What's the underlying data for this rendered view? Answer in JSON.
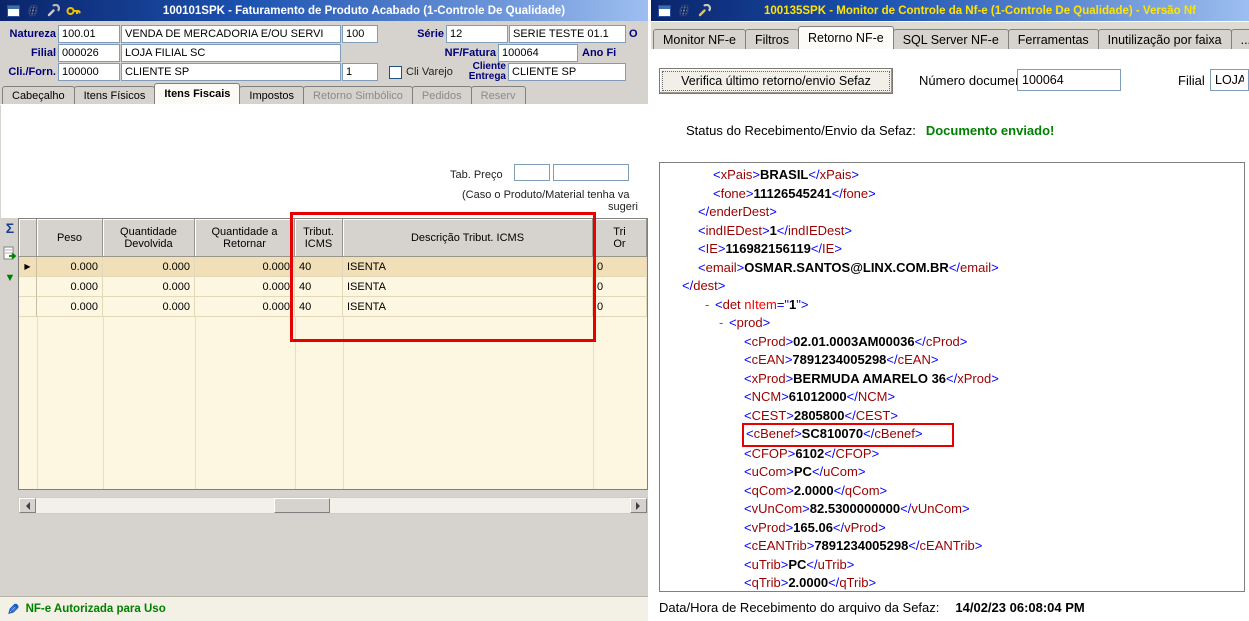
{
  "colors": {
    "status_green": "#008000",
    "highlight_red": "#e60000",
    "xml_tag": "#990000",
    "xml_bracket": "#0000ff",
    "titlebar_blue": "#0a246a"
  },
  "left_window": {
    "title": "100101SPK - Faturamento de Produto Acabado (1-Controle De Qualidade)",
    "form": {
      "natureza_label": "Natureza",
      "natureza_code": "100.01",
      "natureza_desc": "VENDA DE MERCADORIA E/OU SERVI",
      "natureza_num": "100",
      "serie_label": "Série",
      "serie_code": "12",
      "serie_desc": "SERIE TESTE 01.1",
      "right_fragment_row1": "O",
      "filial_label": "Filial",
      "filial_code": "000026",
      "filial_desc": "LOJA FILIAL SC",
      "nf_label": "NF/Fatura",
      "nf_value": "100064",
      "right_fragment_row2": "Ano Fi",
      "cli_label": "Cli./Forn.",
      "cli_code": "100000",
      "cli_desc": "CLIENTE SP",
      "cli_num": "1",
      "cli_varejo_label": "Cli Varejo",
      "cliente_entrega_label": "Cliente\nEntrega",
      "cliente_entrega_value": "CLIENTE SP"
    },
    "tabs": [
      {
        "label": "Cabeçalho",
        "state": "normal"
      },
      {
        "label": "Itens Físicos",
        "state": "normal"
      },
      {
        "label": "Itens Fiscais",
        "state": "active"
      },
      {
        "label": "Impostos",
        "state": "normal"
      },
      {
        "label": "Retorno Simbólico",
        "state": "disabled"
      },
      {
        "label": "Pedidos",
        "state": "disabled"
      },
      {
        "label": "Reserv",
        "state": "disabled"
      }
    ],
    "tab_preco": {
      "label": "Tab. Preço",
      "value1": "",
      "value2": ""
    },
    "note_line1": "(Caso o Produto/Material tenha va",
    "note_line2": "sugeri",
    "grid": {
      "headers": [
        "",
        "Peso",
        "Quantidade\nDevolvida",
        "Quantidade a\nRetornar",
        "Tribut.\nICMS",
        "Descrição Tribut. ICMS",
        "Tri\nOr"
      ],
      "rows": [
        {
          "peso": "0.000",
          "qtd_devolvida": "0.000",
          "qtd_retornar": "0.000",
          "tribut_icms": "40",
          "descricao_tribut_icms": "ISENTA",
          "tri": "0",
          "selected": true
        },
        {
          "peso": "0.000",
          "qtd_devolvida": "0.000",
          "qtd_retornar": "0.000",
          "tribut_icms": "40",
          "descricao_tribut_icms": "ISENTA",
          "tri": "0",
          "selected": false
        },
        {
          "peso": "0.000",
          "qtd_devolvida": "0.000",
          "qtd_retornar": "0.000",
          "tribut_icms": "40",
          "descricao_tribut_icms": "ISENTA",
          "tri": "0",
          "selected": false
        }
      ]
    },
    "statusbar": {
      "message": "NF-e Autorizada para Uso"
    }
  },
  "right_window": {
    "title": "100135SPK - Monitor de Controle da Nf-e (1-Controle De Qualidade) - Versão Nf",
    "tabs": [
      {
        "label": "Monitor NF-e",
        "state": "normal"
      },
      {
        "label": "Filtros",
        "state": "normal"
      },
      {
        "label": "Retorno NF-e",
        "state": "active"
      },
      {
        "label": "SQL Server NF-e",
        "state": "normal"
      },
      {
        "label": "Ferramentas",
        "state": "normal"
      },
      {
        "label": "Inutilização por faixa",
        "state": "normal"
      },
      {
        "label": "...",
        "state": "normal"
      }
    ],
    "toolbar": {
      "verify_button_label": "Verifica último retorno/envio Sefaz",
      "numero_documento_label": "Número documento",
      "numero_documento_value": "100064",
      "filial_label": "Filial",
      "filial_value": "LOJA FILIA"
    },
    "status": {
      "label": "Status do Recebimento/Envio da Sefaz:",
      "value": "Documento enviado!"
    },
    "xml_lines": [
      {
        "depth": 3,
        "type": "leaf",
        "tag": "xPais",
        "value": "BRASIL"
      },
      {
        "depth": 3,
        "type": "leaf",
        "tag": "fone",
        "value": "11126545241"
      },
      {
        "depth": 2,
        "type": "close",
        "tag": "enderDest"
      },
      {
        "depth": 2,
        "type": "leaf",
        "tag": "indIEDest",
        "value": "1"
      },
      {
        "depth": 2,
        "type": "leaf",
        "tag": "IE",
        "value": "116982156119"
      },
      {
        "depth": 2,
        "type": "leaf",
        "tag": "email",
        "value": "OSMAR.SANTOS@LINX.COM.BR"
      },
      {
        "depth": 1,
        "type": "close",
        "tag": "dest"
      },
      {
        "depth": 4,
        "type": "container_attr",
        "tag": "det",
        "attr_name": "nItem",
        "attr_value": "1"
      },
      {
        "depth": 5,
        "type": "container",
        "tag": "prod"
      },
      {
        "depth": 6,
        "type": "leaf",
        "tag": "cProd",
        "value": "02.01.0003AM00036"
      },
      {
        "depth": 6,
        "type": "leaf",
        "tag": "cEAN",
        "value": "7891234005298"
      },
      {
        "depth": 6,
        "type": "leaf",
        "tag": "xProd",
        "value": "BERMUDA AMARELO 36"
      },
      {
        "depth": 6,
        "type": "leaf",
        "tag": "NCM",
        "value": "61012000"
      },
      {
        "depth": 6,
        "type": "leaf",
        "tag": "CEST",
        "value": "2805800"
      },
      {
        "depth": 6,
        "type": "leaf",
        "tag": "cBenef",
        "value": "SC810070",
        "highlight": true
      },
      {
        "depth": 6,
        "type": "leaf",
        "tag": "CFOP",
        "value": "6102"
      },
      {
        "depth": 6,
        "type": "leaf",
        "tag": "uCom",
        "value": "PC"
      },
      {
        "depth": 6,
        "type": "leaf",
        "tag": "qCom",
        "value": "2.0000"
      },
      {
        "depth": 6,
        "type": "leaf",
        "tag": "vUnCom",
        "value": "82.5300000000"
      },
      {
        "depth": 6,
        "type": "leaf",
        "tag": "vProd",
        "value": "165.06"
      },
      {
        "depth": 6,
        "type": "leaf",
        "tag": "cEANTrib",
        "value": "7891234005298"
      },
      {
        "depth": 6,
        "type": "leaf",
        "tag": "uTrib",
        "value": "PC"
      },
      {
        "depth": 6,
        "type": "leaf",
        "tag": "qTrib",
        "value": "2.0000"
      }
    ],
    "footer": {
      "label": "Data/Hora de Recebimento do arquivo da Sefaz:",
      "value": "14/02/23 06:08:04 PM"
    }
  }
}
